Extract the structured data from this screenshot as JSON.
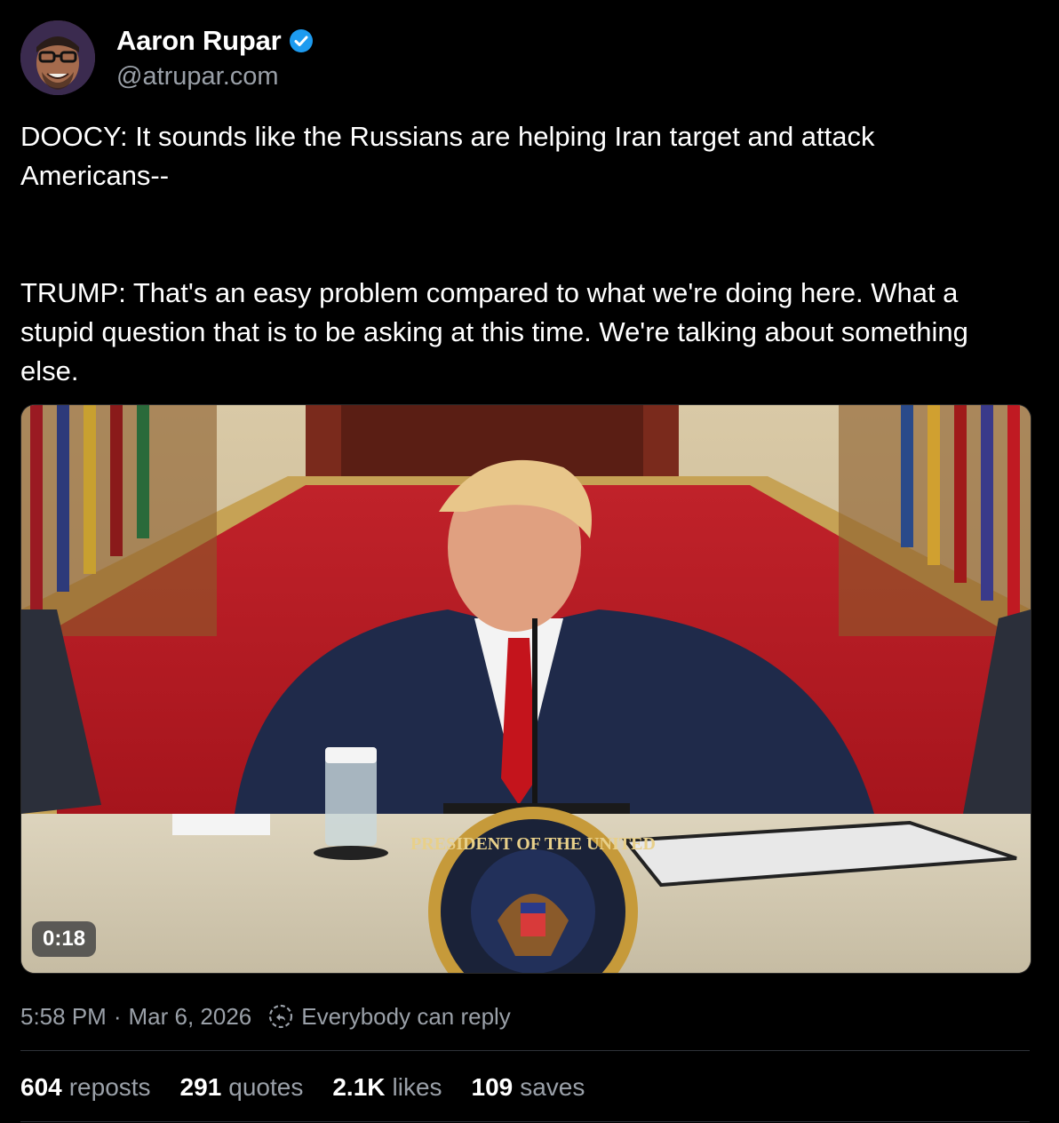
{
  "author": {
    "display_name": "Aaron Rupar",
    "handle": "@atrupar.com",
    "verified": true,
    "verified_color": "#1d9bf0"
  },
  "post": {
    "text": "DOOCY: It sounds like the Russians are helping Iran target and attack Americans--\n\n\nTRUMP: That's an easy problem compared to what we're doing here. What a stupid question that is to be asking at this time. We're talking about something else."
  },
  "video": {
    "duration": "0:18",
    "seal_text_top": "PRESIDENT OF THE UNITED",
    "seal_text_bottom": "OF THE"
  },
  "meta": {
    "time": "5:58 PM",
    "separator": "·",
    "date": "Mar 6, 2026",
    "reply_setting": "Everybody can reply",
    "reply_icon": "reply-settings-icon"
  },
  "stats": {
    "reposts": {
      "value": "604",
      "label": "reposts"
    },
    "quotes": {
      "value": "291",
      "label": "quotes"
    },
    "likes": {
      "value": "2.1K",
      "label": "likes"
    },
    "saves": {
      "value": "109",
      "label": "saves"
    }
  }
}
